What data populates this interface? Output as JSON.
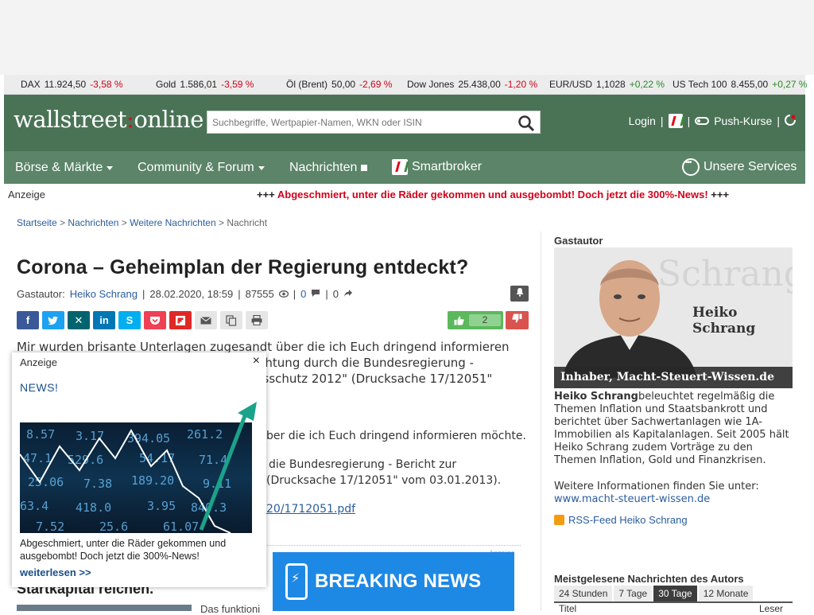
{
  "ticker": [
    {
      "name": "DAX",
      "value": "11.924,50",
      "change": "-3,58 %",
      "dir": "neg"
    },
    {
      "name": "Gold",
      "value": "1.586,01",
      "change": "-3,59 %",
      "dir": "neg"
    },
    {
      "name": "Öl (Brent)",
      "value": "50,00",
      "change": "-2,69 %",
      "dir": "neg"
    },
    {
      "name": "Dow Jones",
      "value": "25.438,00",
      "change": "-1,20 %",
      "dir": "neg"
    },
    {
      "name": "EUR/USD",
      "value": "1,1028",
      "change": "+0,22 %",
      "dir": "pos"
    },
    {
      "name": "US Tech 100",
      "value": "8.455,00",
      "change": "+0,27 %",
      "dir": "pos"
    }
  ],
  "header": {
    "logo_left": "wallstreet",
    "logo_colon": ":",
    "logo_right": "online",
    "search_placeholder": "Suchbegriffe, Wertpapier-Namen, WKN oder ISIN",
    "login": "Login",
    "sep": "|",
    "push": "Push-Kurse"
  },
  "nav": {
    "boerse": "Börse & Märkte",
    "community": "Community & Forum",
    "nachrichten": "Nachrichten",
    "smartbroker": "Smartbroker",
    "services": "Unsere Services"
  },
  "adbar": {
    "label": "Anzeige",
    "prefix": "+++ ",
    "text": "Abgeschmiert, unter die Räder gekommen und ausgebombt! Doch jetzt die 300%-News!",
    "suffix": " +++"
  },
  "breadcrumb": {
    "home": "Startseite",
    "news": "Nachrichten",
    "more": "Weitere Nachrichten",
    "current": "Nachricht",
    "sep": ">"
  },
  "article": {
    "title": "Corona – Geheimplan der Regierung entdeckt?",
    "author_label": "Gastautor:",
    "author": "Heiko Schrang",
    "date": "28.02.2020, 18:59",
    "views": "87555",
    "comments": "0",
    "shares": "0",
    "likes": "2",
    "lead_line1": "Mir wurden brisante Unterlagen zugesandt über die ich Euch dringend informieren",
    "lead_line2": "ichtung durch die Bundesregierung -",
    "lead_line3": "gsschutz 2012\" (Drucksache 17/12051\"",
    "p1": "ber die ich Euch dringend informieren möchte.",
    "p2a": "die Bundesregierung - Bericht zur",
    "p2b": "(Drucksache 17/12051\" vom 03.01.2013).",
    "pdf": "20/1712051.pdf",
    "ad_small": "Anzeige",
    "sub_title": "Startkapital reichen.",
    "teaser": "Das funktioni"
  },
  "ad": {
    "label": "Anzeige",
    "close": "×",
    "brand": "NEWS!",
    "text": "Abgeschmiert, unter die Räder gekommen und ausgebombt! Doch jetzt die 300%-News!",
    "link": "weiterlesen >>"
  },
  "breaking": {
    "label": "BREAKING NEWS"
  },
  "sidebar": {
    "head": "Gastautor",
    "bg_name": "Schrang",
    "photo_name": "Heiko Schrang",
    "caption": "Inhaber, Macht-Steuert-Wissen.de",
    "bio_name": "Heiko Schrang",
    "bio_text": "beleuchtet regelmäßig die Themen Inflation und Staatsbankrott und berichtet über Sachwertanlagen wie 1A-Immobilien als Kapitalanlagen. Seit 2005 hält Heiko Schrang zudem Vorträge zu den Themen Inflation, Gold und Finanzkrisen.",
    "more_label": "Weitere Informationen finden Sie unter:",
    "more_link": "www.macht-steuert-wissen.de",
    "rss": "RSS-Feed Heiko Schrang",
    "most_read": "Meistgelesene Nachrichten des Autors",
    "tabs": [
      "24 Stunden",
      "7 Tage",
      "30 Tage",
      "12 Monate"
    ],
    "active_tab": "30 Tage",
    "col_title": "Titel",
    "col_readers": "Leser"
  },
  "colors": {
    "header_bg": "#4a7356",
    "nav_bg": "#5b8468",
    "negative": "#d0021b",
    "positive": "#2a8a2a",
    "breaking_bg": "#1e88e5"
  }
}
